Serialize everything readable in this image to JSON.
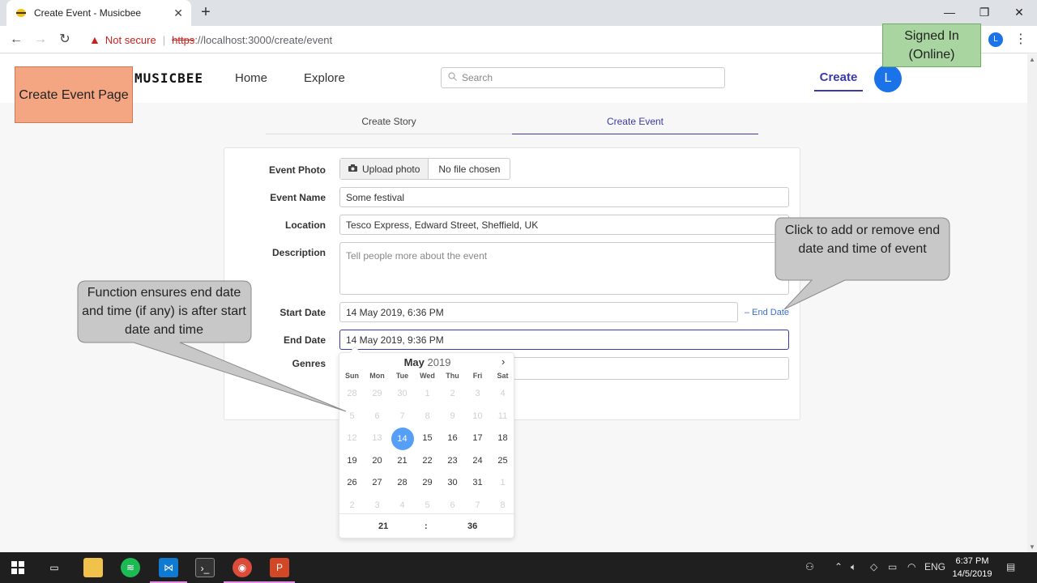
{
  "browser": {
    "tab_title": "Create Event - Musicbee",
    "new_tab": "+",
    "tab_close": "✕",
    "not_secure": "Not secure",
    "url_scheme": "https",
    "url_rest": "://localhost:3000/create/event",
    "profile_initial": "L",
    "window_min": "—",
    "window_restore": "❐",
    "window_close": "✕"
  },
  "app": {
    "logo": "MUSICBEE",
    "nav": {
      "home": "Home",
      "explore": "Explore",
      "create": "Create"
    },
    "search_placeholder": "Search",
    "avatar_initial": "L"
  },
  "subtabs": {
    "story": "Create Story",
    "event": "Create Event"
  },
  "form": {
    "photo_label": "Event Photo",
    "upload_button": "Upload photo",
    "no_file": "No file chosen",
    "name_label": "Event Name",
    "name_value": "Some festival",
    "location_label": "Location",
    "location_value": "Tesco Express, Edward Street, Sheffield, UK",
    "description_label": "Description",
    "description_placeholder": "Tell people more about the event",
    "start_label": "Start Date",
    "start_value": "14 May 2019, 6:36 PM",
    "end_date_toggle": "– End Date",
    "end_label": "End Date",
    "end_value": "14 May 2019, 9:36 PM",
    "genres_label": "Genres"
  },
  "calendar": {
    "month": "May",
    "year": "2019",
    "weekdays": [
      "Sun",
      "Mon",
      "Tue",
      "Wed",
      "Thu",
      "Fri",
      "Sat"
    ],
    "weeks": [
      [
        "28",
        "29",
        "30",
        "1",
        "2",
        "3",
        "4"
      ],
      [
        "5",
        "6",
        "7",
        "8",
        "9",
        "10",
        "11"
      ],
      [
        "12",
        "13",
        "14",
        "15",
        "16",
        "17",
        "18"
      ],
      [
        "19",
        "20",
        "21",
        "22",
        "23",
        "24",
        "25"
      ],
      [
        "26",
        "27",
        "28",
        "29",
        "30",
        "31",
        "1"
      ],
      [
        "2",
        "3",
        "4",
        "5",
        "6",
        "7",
        "8"
      ]
    ],
    "selected_day": "14",
    "hour": "21",
    "separator": ":",
    "minute": "36"
  },
  "annotations": {
    "page_label": "Create Event Page",
    "signed_in": "Signed In (Online)",
    "end_date_note": "Click to add or remove end date and time of event",
    "validation_note": "Function ensures end date and time (if any) is after start date and time"
  },
  "taskbar": {
    "time": "6:37 PM",
    "date": "14/5/2019",
    "lang": "ENG"
  },
  "colors": {
    "accent": "#3a3aa8",
    "selected_day": "#569ff7",
    "annotation_orange": "#f4a582",
    "annotation_green": "#a8d5a0",
    "callout_gray": "#c8c8c8"
  }
}
